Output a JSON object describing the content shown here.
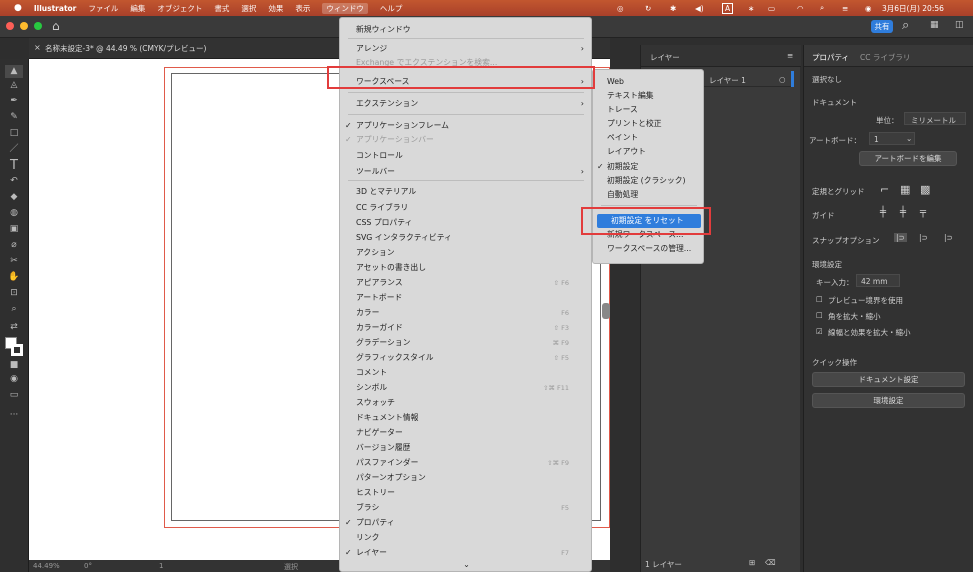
{
  "menubar": {
    "app": "Illustrator",
    "items": [
      "ファイル",
      "編集",
      "オブジェクト",
      "書式",
      "選択",
      "効果",
      "表示",
      "ウィンドウ",
      "ヘルプ"
    ],
    "clock": "3月6日(月) 20:56"
  },
  "doc": {
    "tab": "名称未設定-3* @ 44.49 % (CMYK/プレビュー)",
    "close": "×"
  },
  "status": {
    "zoom": "44.49%",
    "angle": "0°",
    "artboard": "1",
    "mode": "選択"
  },
  "window_menu": {
    "items": [
      {
        "label": "新規ウィンドウ"
      },
      {
        "label": "アレンジ",
        "arrow": "›"
      },
      {
        "label": "Exchange でエクステンションを検索...",
        "dis": true
      },
      {
        "label": "ワークスペース",
        "arrow": "›"
      },
      {
        "label": "エクステンション",
        "arrow": "›"
      },
      {
        "label": "アプリケーションフレーム",
        "check": "✓"
      },
      {
        "label": "アプリケーションバー",
        "check": "✓",
        "dis": true
      },
      {
        "label": "コントロール"
      },
      {
        "label": "ツールバー",
        "arrow": "›"
      },
      {
        "label": "3D とマテリアル"
      },
      {
        "label": "CC ライブラリ"
      },
      {
        "label": "CSS プロパティ"
      },
      {
        "label": "SVG インタラクティビティ"
      },
      {
        "label": "アクション"
      },
      {
        "label": "アセットの書き出し"
      },
      {
        "label": "アピアランス",
        "shortcut": "⇧ F6"
      },
      {
        "label": "アートボード"
      },
      {
        "label": "カラー",
        "shortcut": "F6"
      },
      {
        "label": "カラーガイド",
        "shortcut": "⇧ F3"
      },
      {
        "label": "グラデーション",
        "shortcut": "⌘ F9"
      },
      {
        "label": "グラフィックスタイル",
        "shortcut": "⇧ F5"
      },
      {
        "label": "コメント"
      },
      {
        "label": "シンボル",
        "shortcut": "⇧⌘ F11"
      },
      {
        "label": "スウォッチ"
      },
      {
        "label": "ドキュメント情報"
      },
      {
        "label": "ナビゲーター"
      },
      {
        "label": "バージョン履歴"
      },
      {
        "label": "パスファインダー",
        "shortcut": "⇧⌘ F9"
      },
      {
        "label": "パターンオプション"
      },
      {
        "label": "ヒストリー"
      },
      {
        "label": "ブラシ",
        "shortcut": "F5"
      },
      {
        "label": "プロパティ",
        "check": "✓"
      },
      {
        "label": "リンク"
      },
      {
        "label": "レイヤー",
        "check": "✓",
        "shortcut": "F7"
      }
    ],
    "more": "⌄"
  },
  "workspace_menu": {
    "items": [
      {
        "label": "Web"
      },
      {
        "label": "テキスト編集"
      },
      {
        "label": "トレース"
      },
      {
        "label": "プリントと校正"
      },
      {
        "label": "ペイント"
      },
      {
        "label": "レイアウト"
      },
      {
        "label": "初期設定",
        "check": "✓"
      },
      {
        "label": "初期設定 (クラシック)"
      },
      {
        "label": "自動処理"
      },
      {
        "label": "初期設定 をリセット"
      },
      {
        "label": "新規ワークスペース..."
      },
      {
        "label": "ワークスペースの管理..."
      }
    ]
  },
  "layers": {
    "tab": "レイヤー",
    "layer": "レイヤー 1",
    "count": "1 レイヤー"
  },
  "props": {
    "tabs": [
      "プロパティ",
      "CC ライブラリ"
    ],
    "nosel": "選択なし",
    "doc": "ドキュメント",
    "unit_label": "単位：",
    "unit": "ミリメートル",
    "artboard_label": "アートボード：",
    "artboard": "1",
    "edit_ab": "アートボードを編集",
    "rulers": "定規とグリッド",
    "guides": "ガイド",
    "snap": "スナップオプション",
    "prefs": "環境設定",
    "key": "キー入力：",
    "key_val": "42 mm",
    "preview": "プレビュー境界を使用",
    "corners": "角を拡大・縮小",
    "strokes": "線幅と効果を拡大・縮小",
    "quick": "クイック操作",
    "docsettings": "ドキュメント設定",
    "prefs_btn": "環境設定"
  },
  "colors": {
    "menubar": "#b84a2c",
    "highlight": "#e23c3c",
    "select": "#2f7ddc"
  }
}
